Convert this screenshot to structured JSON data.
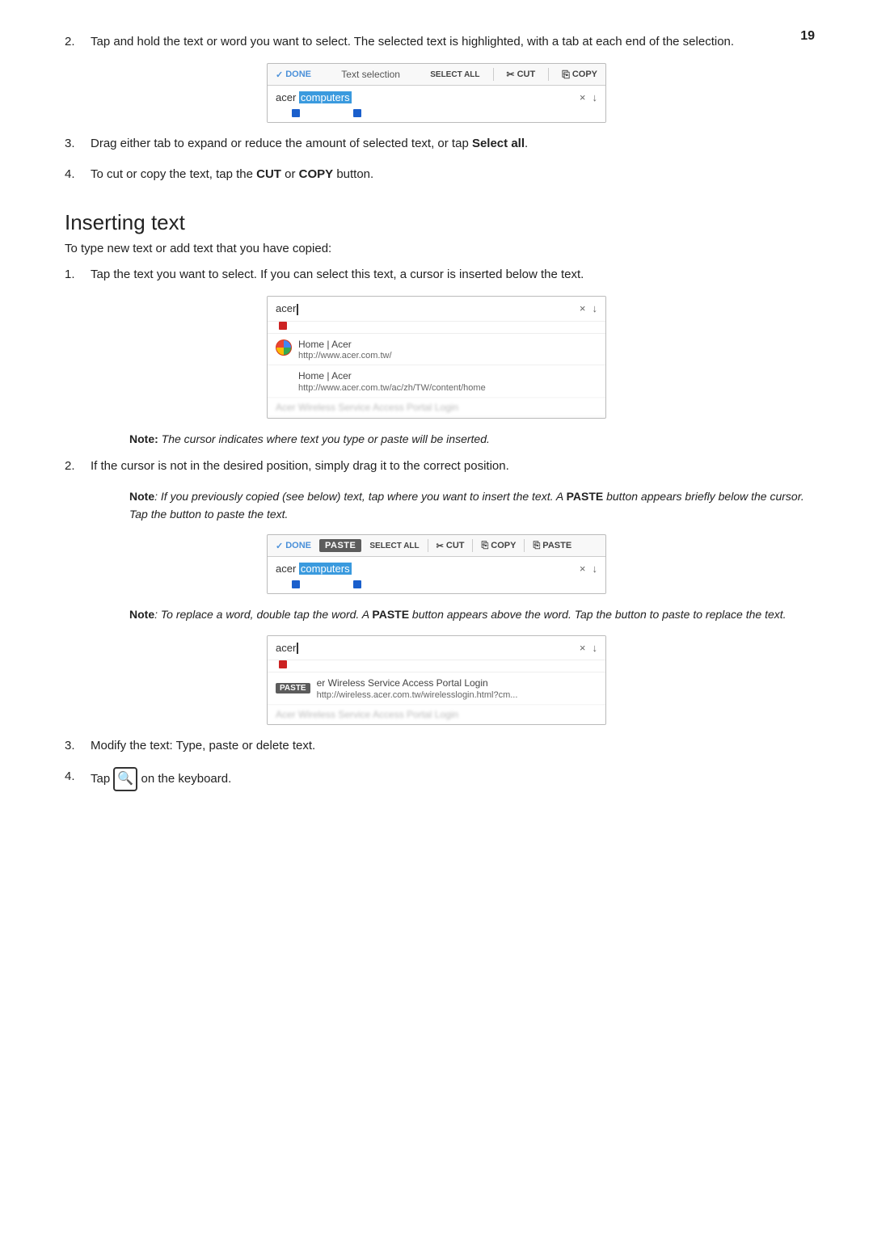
{
  "page": {
    "number": "19"
  },
  "step2": {
    "text": "Tap and hold the text or word you want to select. The selected text is highlighted, with a tab at each end of the selection."
  },
  "toolbar1": {
    "done_label": "DONE",
    "middle_label": "Text selection",
    "select_all": "SELECT ALL",
    "cut_label": "CUT",
    "copy_label": "COPY",
    "input_text_before": "acer ",
    "input_text_highlighted": "computers",
    "x_icon": "×",
    "mic_icon": "↓"
  },
  "step3": {
    "text": "Drag either tab to expand or reduce the amount of selected text, or tap "
  },
  "step3b": {
    "bold": "Select all"
  },
  "step4": {
    "text": "To cut or copy the text, tap the ",
    "cut": "CUT",
    "or": " or ",
    "copy": "COPY",
    "end": " button."
  },
  "section_inserting": {
    "title": "Inserting text",
    "intro": "To type new text or add text that you have copied:"
  },
  "ins_step1": {
    "text": "Tap the text you want to select. If you can select this text, a cursor is inserted below the text."
  },
  "toolbar2": {
    "input_text": "acer",
    "x_icon": "×",
    "mic_icon": "↓",
    "result1_title": "Home | Acer",
    "result1_url": "http://www.acer.com.tw/",
    "result2_title": "Home | Acer",
    "result2_url": "http://www.acer.com.tw/ac/zh/TW/content/home",
    "result3_blur": "Acer Wireless Service Access Portal Login"
  },
  "note1": {
    "label": "Note:",
    "text": " The cursor indicates where text you type or paste will be inserted."
  },
  "ins_step2": {
    "text": "If the cursor is not in the desired position, simply drag it to the correct position."
  },
  "note2": {
    "label": "Note",
    "text": ": If you previously copied (see below) text, tap where you want to insert the text. A ",
    "paste_bold": "PASTE",
    "text2": " button appears briefly below the cursor. Tap the button to paste the text."
  },
  "toolbar3": {
    "done_label": "DONE",
    "paste_label": "PASTE",
    "select_all": "SELECT ALL",
    "cut_label": "CUT",
    "copy_label": "COPY",
    "paste_label2": "PASTE",
    "input_before": "acer ",
    "input_highlighted": "computers",
    "x_icon": "×",
    "mic_icon": "↓"
  },
  "note3": {
    "label": "Note",
    "text": ": To replace a word, double tap the word. A ",
    "paste_bold": "PASTE",
    "text2": " button appears above the word. Tap the button to paste to replace the text."
  },
  "toolbar4": {
    "input_text": "acer",
    "cursor": true,
    "x_icon": "×",
    "mic_icon": "↓",
    "paste_label": "PASTE",
    "suggestion_text": "er Wireless Service Access Portal Login",
    "suggestion_url": "http://wireless.acer.com.tw/wirelesslogin.html?cm...",
    "blur_text": "Acer Wireless Service Access Portal Login"
  },
  "ins_step3": {
    "text": "Modify the text: Type, paste or delete text."
  },
  "ins_step4": {
    "text": "Tap ",
    "icon": "search",
    "text2": " on the keyboard."
  }
}
